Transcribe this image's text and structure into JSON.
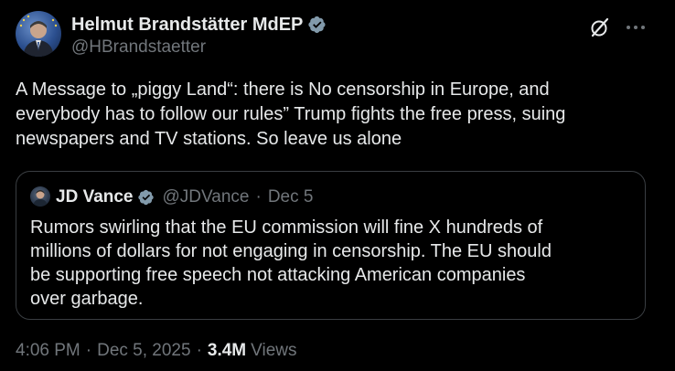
{
  "author": {
    "display_name": "Helmut Brandstätter MdEP",
    "handle": "@HBrandstaetter",
    "verified": true
  },
  "tweet_text_lines": [
    "A Message to „piggy Land“: there is No censorship in Europe, and",
    "everybody has to follow our rules” Trump fights the free press, suing",
    "newspapers and TV stations. So leave us alone"
  ],
  "quoted": {
    "display_name": "JD Vance",
    "handle": "@JDVance",
    "separator": "·",
    "date": "Dec 5",
    "verified": true,
    "text_lines": [
      "Rumors swirling that the EU commission will fine X hundreds of",
      "millions of dollars for not engaging in censorship. The EU should",
      "be supporting free speech not attacking American companies",
      "over garbage."
    ]
  },
  "meta": {
    "time": "4:06 PM",
    "sep1": "·",
    "date": "Dec 5, 2025",
    "sep2": "·",
    "views_count": "3.4M",
    "views_label": "Views"
  },
  "icons": {
    "verified": "verified-badge-icon",
    "grok": "grok-icon",
    "more": "more-options-icon"
  },
  "colors": {
    "background": "#000000",
    "primary_text": "#e7e9ea",
    "secondary_text": "#71767b",
    "border": "#3a3e42",
    "verified_badge": "#829aab"
  }
}
